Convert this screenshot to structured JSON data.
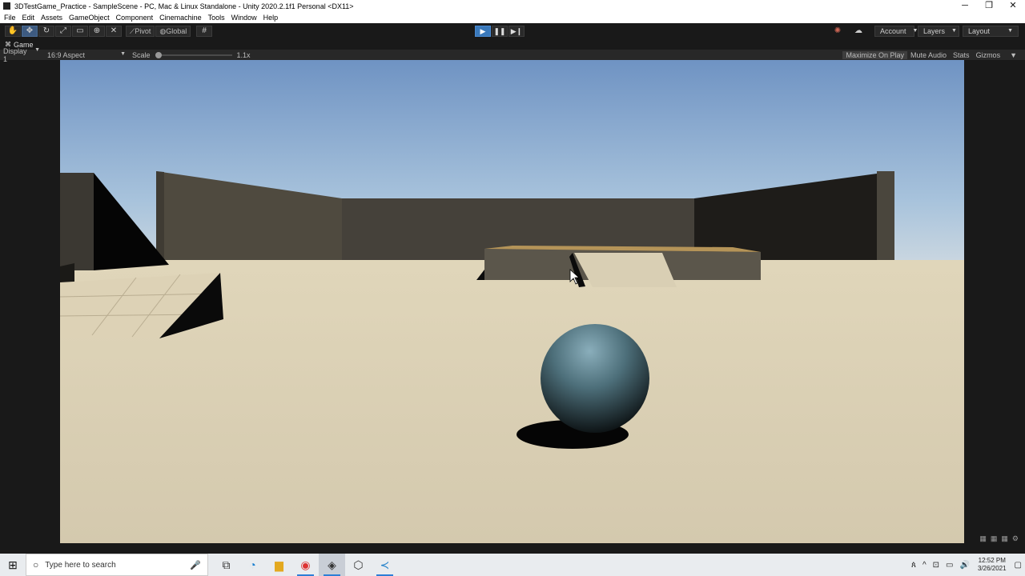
{
  "window": {
    "title": "3DTestGame_Practice - SampleScene - PC, Mac & Linux Standalone - Unity 2020.2.1f1 Personal <DX11>",
    "controls": [
      "─",
      "❐",
      "✕"
    ]
  },
  "menu": [
    "File",
    "Edit",
    "Assets",
    "GameObject",
    "Component",
    "Cinemachine",
    "Tools",
    "Window",
    "Help"
  ],
  "toolbar": {
    "tools": [
      "hand-tool-icon",
      "move-tool-icon",
      "rotate-tool-icon",
      "scale-tool-icon",
      "rect-tool-icon",
      "transform-tool-icon",
      "custom-tool-icon"
    ],
    "pivot_label": "Pivot",
    "global_label": "Global",
    "play_state": "playing",
    "account_label": "Account",
    "layers_label": "Layers",
    "layout_label": "Layout"
  },
  "game_view": {
    "tab_label": "Game",
    "display_label": "Display 1",
    "aspect_label": "16:9 Aspect",
    "scale_label": "Scale",
    "scale_value": "1.1x",
    "maximize_label": "Maximize On Play",
    "mute_label": "Mute Audio",
    "stats_label": "Stats",
    "gizmos_label": "Gizmos"
  },
  "taskbar": {
    "search_placeholder": "Type here to search",
    "apps": [
      "task-view-icon",
      "edge-icon",
      "file-explorer-icon",
      "chrome-icon",
      "unity-icon",
      "unity-hub-icon",
      "vscode-icon"
    ],
    "time": "12:52 PM",
    "date": "3/26/2021"
  }
}
